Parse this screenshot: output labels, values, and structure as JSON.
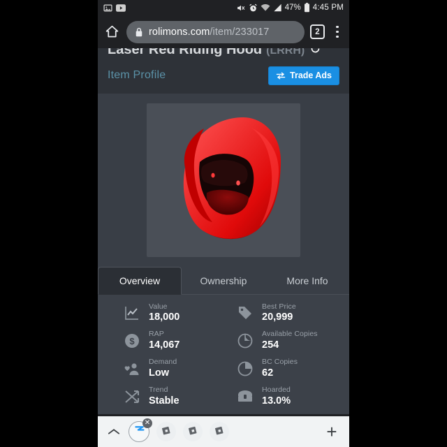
{
  "status_bar": {
    "left_icons": [
      "image-icon",
      "youtube-icon"
    ],
    "right_icons": [
      "volume-mute-icon",
      "alarm-clock-icon",
      "wifi-icon",
      "cell-signal-icon",
      "battery-icon"
    ],
    "battery_percent": "47%",
    "time": "4:45 PM"
  },
  "browser": {
    "home_icon": "home-icon",
    "lock_icon": "lock-icon",
    "url_domain": "rolimons.com",
    "url_path": "/item/233017",
    "tab_count": "2",
    "menu_icon": "overflow-menu-icon"
  },
  "item": {
    "title": "Laser Red Riding Hood",
    "acronym": "(LRRH)",
    "refresh_icon": "refresh-icon",
    "profile_link": "Item Profile",
    "trade_ads_label": "Trade Ads",
    "trade_ads_icon": "exchange-arrows-icon",
    "thumbnail_alt": "red-hood-item-render"
  },
  "tabs": [
    {
      "label": "Overview",
      "active": true
    },
    {
      "label": "Ownership",
      "active": false
    },
    {
      "label": "More Info",
      "active": false
    }
  ],
  "stats": {
    "left": [
      {
        "icon": "line-chart-icon",
        "label": "Value",
        "value": "18,000"
      },
      {
        "icon": "dollar-circle-icon",
        "label": "RAP",
        "value": "14,067"
      },
      {
        "icon": "demand-people-icon",
        "label": "Demand",
        "value": "Low"
      },
      {
        "icon": "trend-arrows-icon",
        "label": "Trend",
        "value": "Stable"
      }
    ],
    "right": [
      {
        "icon": "price-tag-icon",
        "label": "Best Price",
        "value": "20,999"
      },
      {
        "icon": "pie-chart-filled-icon",
        "label": "Available Copies",
        "value": "254"
      },
      {
        "icon": "pie-chart-outline-icon",
        "label": "BC Copies",
        "value": "62"
      },
      {
        "icon": "treasure-chest-icon",
        "label": "Hoarded",
        "value": "13.0%"
      }
    ]
  },
  "bottom_bar": {
    "expand_icon": "chevron-up-icon",
    "tab_chips": [
      {
        "icon": "rolimons-logo-icon",
        "active": true,
        "close_label": "✕"
      },
      {
        "icon": "roblox-logo-icon",
        "active": false
      },
      {
        "icon": "roblox-logo-icon",
        "active": false
      },
      {
        "icon": "roblox-logo-icon",
        "active": false
      }
    ],
    "new_tab_label": "+"
  },
  "colors": {
    "accent_blue": "#1a8fe3",
    "page_bg": "#393e46",
    "header_bg": "#2e3238",
    "stat_bg": "#3c4149",
    "link_teal": "#5b92a8",
    "chrome_bg": "#202124"
  }
}
